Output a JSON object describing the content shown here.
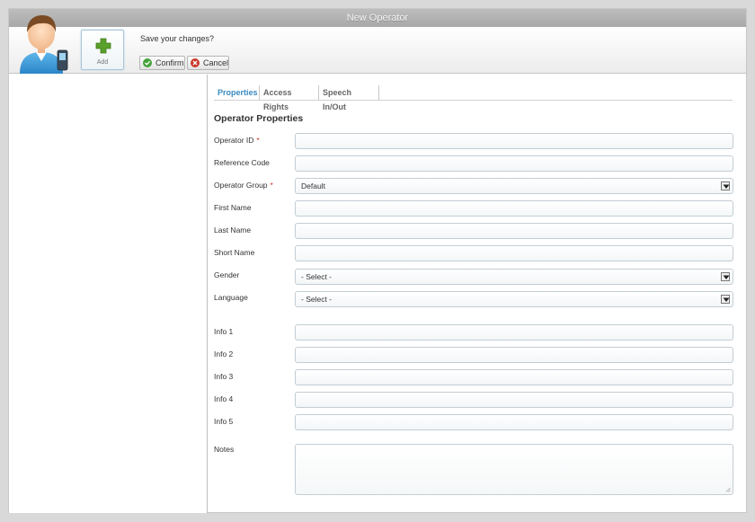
{
  "window": {
    "title": "New Operator"
  },
  "toolbar": {
    "add_label": "Add",
    "prompt": "Save your changes?",
    "confirm_label": "Confirm",
    "cancel_label": "Cancel"
  },
  "tabs": [
    {
      "label": "Properties",
      "active": true
    },
    {
      "label": "Access Rights",
      "active": false
    },
    {
      "label": "Speech In/Out",
      "active": false
    }
  ],
  "form": {
    "section_title": "Operator Properties",
    "required_marker": "*",
    "fields": [
      {
        "label": "Operator ID",
        "required": true,
        "type": "text",
        "value": ""
      },
      {
        "label": "Reference Code",
        "required": false,
        "type": "text",
        "value": ""
      },
      {
        "label": "Operator Group",
        "required": true,
        "type": "select",
        "value": "Default"
      },
      {
        "label": "First Name",
        "required": false,
        "type": "text",
        "value": ""
      },
      {
        "label": "Last Name",
        "required": false,
        "type": "text",
        "value": ""
      },
      {
        "label": "Short Name",
        "required": false,
        "type": "text",
        "value": ""
      },
      {
        "label": "Gender",
        "required": false,
        "type": "select",
        "value": "- Select -"
      },
      {
        "label": "Language",
        "required": false,
        "type": "select",
        "value": "- Select -"
      },
      {
        "label": "Info 1",
        "required": false,
        "type": "text",
        "value": ""
      },
      {
        "label": "Info 2",
        "required": false,
        "type": "text",
        "value": ""
      },
      {
        "label": "Info 3",
        "required": false,
        "type": "text",
        "value": ""
      },
      {
        "label": "Info 4",
        "required": false,
        "type": "text",
        "value": ""
      },
      {
        "label": "Info 5",
        "required": false,
        "type": "text",
        "value": ""
      },
      {
        "label": "Notes",
        "required": false,
        "type": "textarea",
        "value": ""
      }
    ]
  },
  "colors": {
    "accent_tab": "#3a8bc1",
    "required": "#d0312d",
    "confirm_icon": "#45a23a",
    "cancel_icon": "#c93a2b",
    "add_icon": "#5aa02c"
  }
}
